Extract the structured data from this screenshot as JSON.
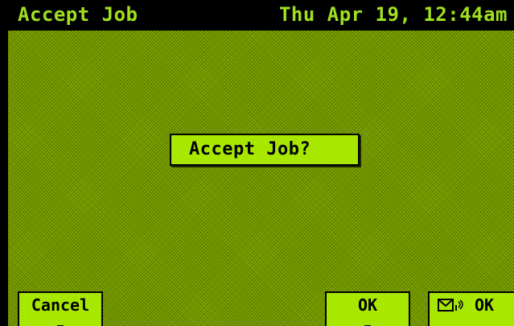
{
  "titlebar": {
    "title": "Accept Job",
    "datetime": "Thu Apr 19, 12:44am"
  },
  "dialog": {
    "text": "Accept Job?"
  },
  "softkeys": {
    "cancel": "Cancel",
    "ok": "OK",
    "msg_ok": "OK",
    "msg_icon": "envelope-signal-icon"
  },
  "colors": {
    "background": "#80a800",
    "highlight": "#a8e800",
    "titlebar_bg": "#000000",
    "titlebar_text": "#a0e020"
  }
}
